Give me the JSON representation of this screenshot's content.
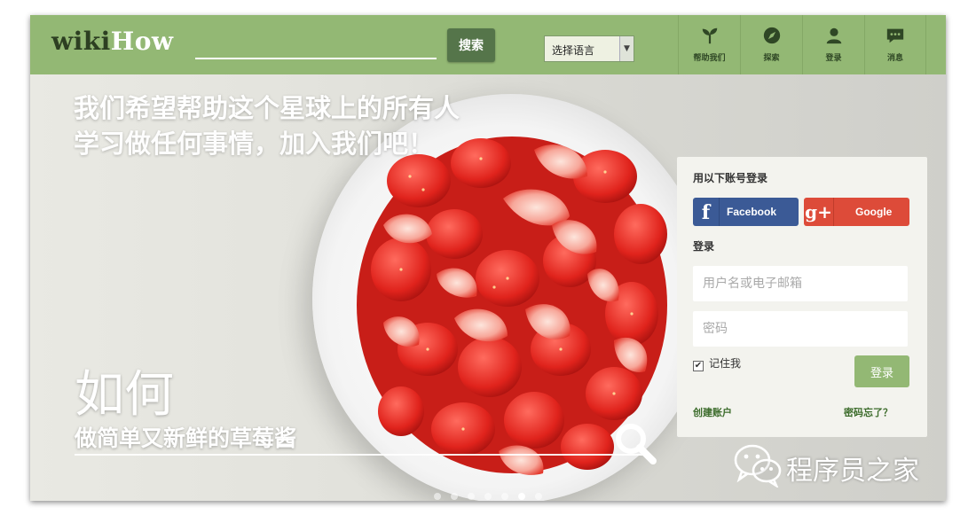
{
  "header": {
    "logo_wiki": "wiki",
    "logo_how": "How",
    "search_placeholder": "",
    "search_button": "搜索",
    "language_select": "选择语言",
    "nav": [
      {
        "label": "帮助我们",
        "icon": "sprout-icon"
      },
      {
        "label": "探索",
        "icon": "compass-icon"
      },
      {
        "label": "登录",
        "icon": "user-icon"
      },
      {
        "label": "消息",
        "icon": "chat-bubble-icon"
      }
    ]
  },
  "hero": {
    "tagline_line1": "我们希望帮助这个星球上的所有人",
    "tagline_line2": "学习做任何事情，加入我们吧！",
    "howto_title": "如何",
    "howto_subtitle": "做简单又新鲜的草莓酱",
    "slide_count": 7,
    "active_slide": 6
  },
  "login_panel": {
    "social_title": "用以下账号登录",
    "facebook_label": "Facebook",
    "google_label": "Google",
    "login_label": "登录",
    "username_placeholder": "用户名或电子邮箱",
    "password_placeholder": "密码",
    "remember_me": "记住我",
    "remember_checked": true,
    "login_button": "登录",
    "create_account": "创建账户",
    "forgot_password": "密码忘了？"
  },
  "watermark": {
    "text": "程序员之家"
  },
  "colors": {
    "header_green": "#93b874",
    "facebook_blue": "#3b5a96",
    "google_red": "#dd4b39"
  }
}
